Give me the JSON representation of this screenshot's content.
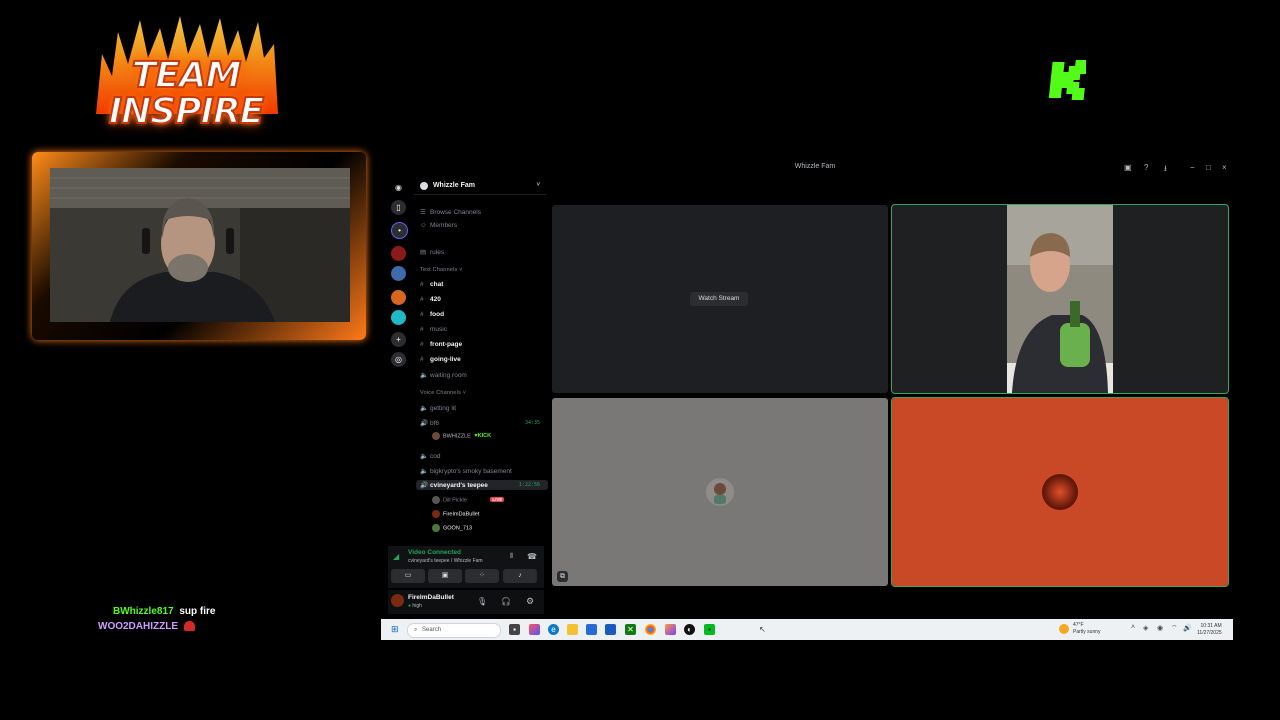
{
  "overlay": {
    "logo_line1": "TEAM",
    "logo_line2": "INSPIRE",
    "kick_logo": "K",
    "chat": [
      {
        "user": "BWhizzle817",
        "user_color": "#53fc18",
        "message": "sup fire"
      },
      {
        "user": "WOO2DAHIZZLE",
        "user_color": "#c9a0ff",
        "message": ""
      }
    ]
  },
  "discord": {
    "window_title": "Whizzle Fam",
    "server_name": "Whizzle Fam",
    "browse_channels": "Browse Channels",
    "members": "Members",
    "rules": "rules",
    "text_category": "Text Channels",
    "text_channels": [
      {
        "name": "chat",
        "unread": true
      },
      {
        "name": "420",
        "unread": true
      },
      {
        "name": "food",
        "unread": true
      },
      {
        "name": "music",
        "unread": false
      },
      {
        "name": "front-page",
        "unread": true
      },
      {
        "name": "going-live",
        "unread": true
      },
      {
        "name": "waiting room",
        "unread": false
      }
    ],
    "voice_category": "Voice Channels",
    "voice_channels": {
      "getting_lit": "getting lit",
      "bf6": "bf6",
      "bf6_timer": "34:35",
      "bf6_user": "BWHIZZLE",
      "bf6_user_badge": "KICK",
      "cod": "cod",
      "basement": "bigkrypto's smoky basement",
      "teepee": "cvineyard's teepee",
      "teepee_timer": "1:22:56",
      "teepee_users": [
        "Dill Pickle",
        "FireImDaBullet",
        "GOON_713"
      ],
      "live_badge": "LIVE"
    },
    "voice_status": "Video Connected",
    "voice_location": "cvineyard's teepee / Whizzle Fam",
    "user": {
      "name": "FireImDaBullet",
      "status": "high"
    },
    "watch_stream": "Watch Stream"
  },
  "taskbar": {
    "search_placeholder": "Search",
    "weather_temp": "47°F",
    "weather_desc": "Partly sunny",
    "time": "10:31 AM",
    "date": "11/27/2025"
  },
  "colors": {
    "accent_green": "#23a55a",
    "kick_green": "#53fc18",
    "tile_orange": "#c94826",
    "live_red": "#ed4245"
  }
}
